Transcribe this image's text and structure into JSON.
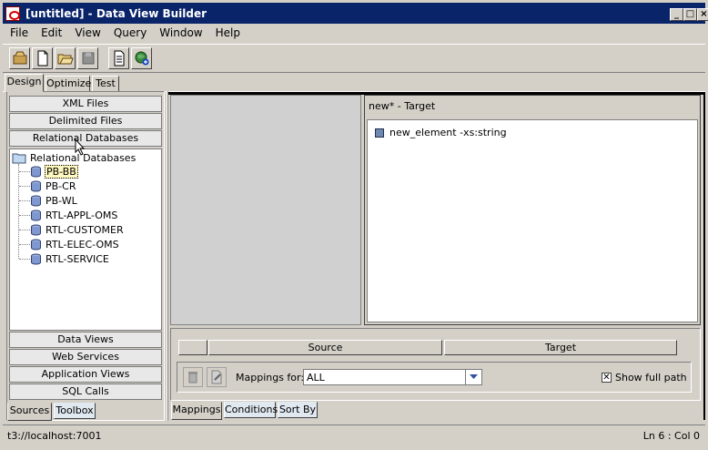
{
  "window": {
    "title": "[untitled] - Data View Builder"
  },
  "menu": [
    {
      "label": "File",
      "key": "F"
    },
    {
      "label": "Edit",
      "key": "E"
    },
    {
      "label": "View",
      "key": "V"
    },
    {
      "label": "Query",
      "key": "Q"
    },
    {
      "label": "Window",
      "key": "W"
    },
    {
      "label": "Help",
      "key": "H"
    }
  ],
  "tabs_top": [
    "Design",
    "Optimize",
    "Test"
  ],
  "categories_top": [
    "XML Files",
    "Delimited Files",
    "Relational Databases"
  ],
  "tree": {
    "root": "Relational Databases",
    "items": [
      "PB-BB",
      "PB-CR",
      "PB-WL",
      "RTL-APPL-OMS",
      "RTL-CUSTOMER",
      "RTL-ELEC-OMS",
      "RTL-SERVICE"
    ]
  },
  "categories_bottom": [
    "Data Views",
    "Web Services",
    "Application Views",
    "SQL Calls"
  ],
  "tabs_left_bottom": [
    "Sources",
    "Toolbox"
  ],
  "target": {
    "header": "new* - Target",
    "element": "new_element -xs:string"
  },
  "mappings": {
    "col_source": "Source",
    "col_target": "Target",
    "mappings_for_label": "Mappings for:",
    "mappings_for_value": "ALL",
    "show_full_path": "Show full path"
  },
  "tabs_bottom": [
    "Mappings",
    "Conditions",
    "Sort By"
  ],
  "status": {
    "left": "t3://localhost:7001",
    "right": "Ln 6 : Col 0"
  }
}
